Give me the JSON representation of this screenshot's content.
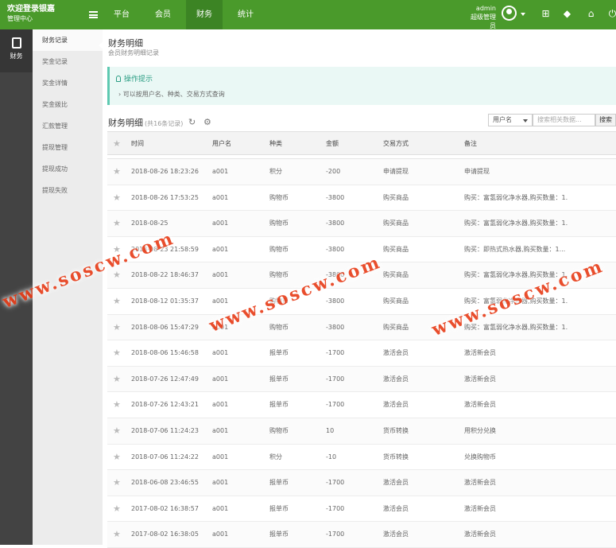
{
  "header": {
    "brand_title": "欢迎登录银嘉",
    "brand_sub": "管理中心",
    "nav": [
      "平台",
      "会员",
      "财务",
      "统计"
    ],
    "active_nav": "财务",
    "user_name": "admin",
    "user_role": "超级管理员"
  },
  "iconbar": {
    "label": "财务"
  },
  "submenu": {
    "items": [
      "财务记录",
      "奖金记录",
      "奖金详情",
      "奖金拨比",
      "汇款管理",
      "提现管理",
      "提现成功",
      "提现失败"
    ],
    "active": "财务记录"
  },
  "page": {
    "title": "财务明细",
    "subtitle": "会员财务明细记录"
  },
  "tip": {
    "title": "操作提示",
    "text": "可以按用户名、种类、交易方式查询"
  },
  "list": {
    "title": "财务明细",
    "count": "(共16条记录)"
  },
  "search": {
    "select_value": "用户名",
    "placeholder": "搜索相关数据...",
    "button": "搜索"
  },
  "table": {
    "columns": [
      "时间",
      "用户名",
      "种类",
      "金额",
      "交易方式",
      "备注"
    ],
    "rows": [
      [
        "2018-08-26 18:23:26",
        "a001",
        "积分",
        "-200",
        "申请提现",
        "申请提现"
      ],
      [
        "2018-08-26 17:53:25",
        "a001",
        "购物币",
        "-3800",
        "购买商品",
        "购买：富氢弱化净水器,购买数量：1..."
      ],
      [
        "2018-08-25",
        "a001",
        "购物币",
        "-3800",
        "购买商品",
        "购买：富氢弱化净水器,购买数量：1..."
      ],
      [
        "2018-08-23 21:58:59",
        "a001",
        "购物币",
        "-3800",
        "购买商品",
        "购买：即热式热水器,购买数量：1..."
      ],
      [
        "2018-08-22 18:46:37",
        "a001",
        "购物币",
        "-3800",
        "购买商品",
        "购买：富氢弱化净水器,购买数量：1..."
      ],
      [
        "2018-08-12 01:35:37",
        "a001",
        "购物币",
        "-3800",
        "购买商品",
        "购买：富氢弱化净水器,购买数量：1..."
      ],
      [
        "2018-08-06 15:47:29",
        "a001",
        "购物币",
        "-3800",
        "购买商品",
        "购买：富氢弱化净水器,购买数量：1..."
      ],
      [
        "2018-08-06 15:46:58",
        "a001",
        "报单币",
        "-1700",
        "激活会员",
        "激活新会员"
      ],
      [
        "2018-07-26 12:47:49",
        "a001",
        "报单币",
        "-1700",
        "激活会员",
        "激活新会员"
      ],
      [
        "2018-07-26 12:43:21",
        "a001",
        "报单币",
        "-1700",
        "激活会员",
        "激活新会员"
      ],
      [
        "2018-07-06 11:24:23",
        "a001",
        "购物币",
        "10",
        "货币转换",
        "用积分兑换"
      ],
      [
        "2018-07-06 11:24:22",
        "a001",
        "积分",
        "-10",
        "货币转换",
        "兑换购物币"
      ],
      [
        "2018-06-08 23:46:55",
        "a001",
        "报单币",
        "-1700",
        "激活会员",
        "激活新会员"
      ],
      [
        "2017-08-02 16:38:57",
        "a001",
        "报单币",
        "-1700",
        "激活会员",
        "激活新会员"
      ],
      [
        "2017-08-02 16:38:05",
        "a001",
        "报单币",
        "-1700",
        "激活会员",
        "激活新会员"
      ]
    ]
  },
  "watermark": "www.soscw.com",
  "colors": {
    "header_green": "#4a9a2b",
    "tip_accent": "#5ec9b1",
    "watermark": "#e8401c"
  }
}
